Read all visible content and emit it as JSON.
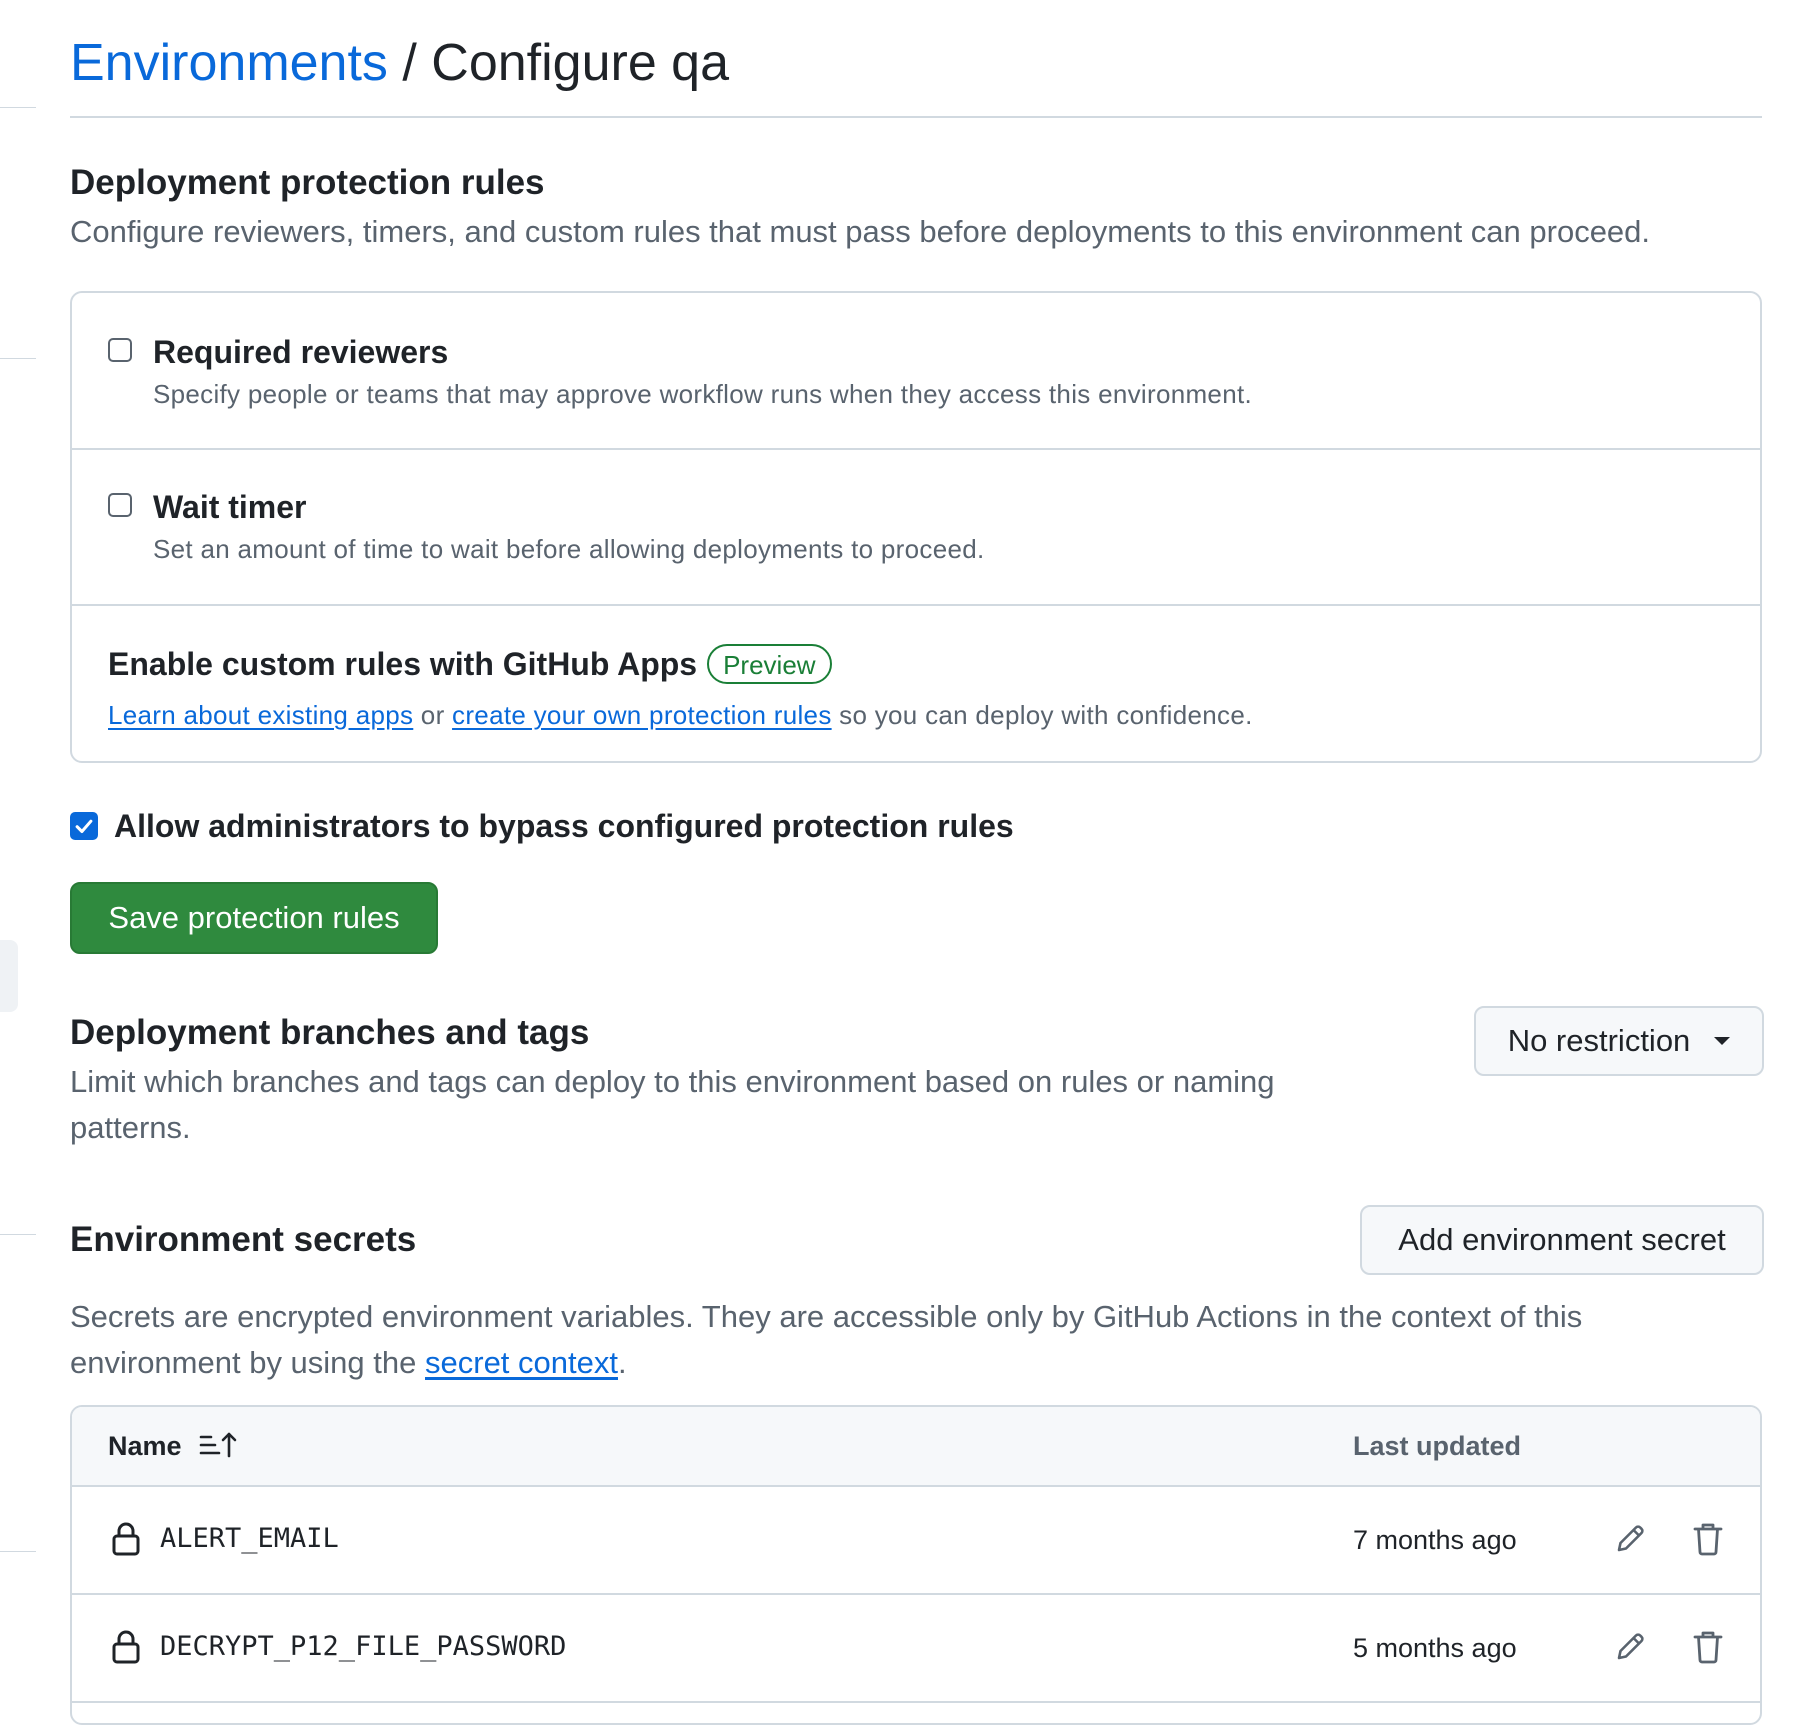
{
  "breadcrumb": {
    "parent": "Environments",
    "separator": " / ",
    "current": "Configure qa"
  },
  "protection": {
    "title": "Deployment protection rules",
    "description": "Configure reviewers, timers, and custom rules that must pass before deployments to this environment can proceed.",
    "rules": [
      {
        "title": "Required reviewers",
        "description": "Specify people or teams that may approve workflow runs when they access this environment.",
        "checked": false
      },
      {
        "title": "Wait timer",
        "description": "Set an amount of time to wait before allowing deployments to proceed.",
        "checked": false
      }
    ],
    "custom_rules": {
      "title": "Enable custom rules with GitHub Apps",
      "badge": "Preview",
      "link1": "Learn about existing apps",
      "text_or": " or ",
      "link2": "create your own protection rules",
      "text_after": " so you can deploy with confidence."
    },
    "admin_bypass": {
      "label": "Allow administrators to bypass configured protection rules",
      "checked": true
    },
    "save_label": "Save protection rules"
  },
  "branches": {
    "title": "Deployment branches and tags",
    "description": "Limit which branches and tags can deploy to this environment based on rules or naming patterns.",
    "dropdown_value": "No restriction"
  },
  "secrets": {
    "title": "Environment secrets",
    "add_label": "Add environment secret",
    "description_before": "Secrets are encrypted environment variables. They are accessible only by GitHub Actions in the context of this environment by using the ",
    "description_link": "secret context",
    "description_after": ".",
    "columns": {
      "name": "Name",
      "updated": "Last updated"
    },
    "rows": [
      {
        "name": "ALERT_EMAIL",
        "updated": "7 months ago"
      },
      {
        "name": "DECRYPT_P12_FILE_PASSWORD",
        "updated": "5 months ago"
      }
    ]
  },
  "colors": {
    "link": "#0969da",
    "primary_button": "#2f8a3e",
    "preview_badge": "#1a7f37",
    "checkbox_checked": "#0969da"
  },
  "icons": {
    "sort": "sort-ascending-icon",
    "lock": "lock-icon",
    "edit": "pencil-icon",
    "delete": "trash-icon",
    "dropdown": "caret-down-icon"
  }
}
